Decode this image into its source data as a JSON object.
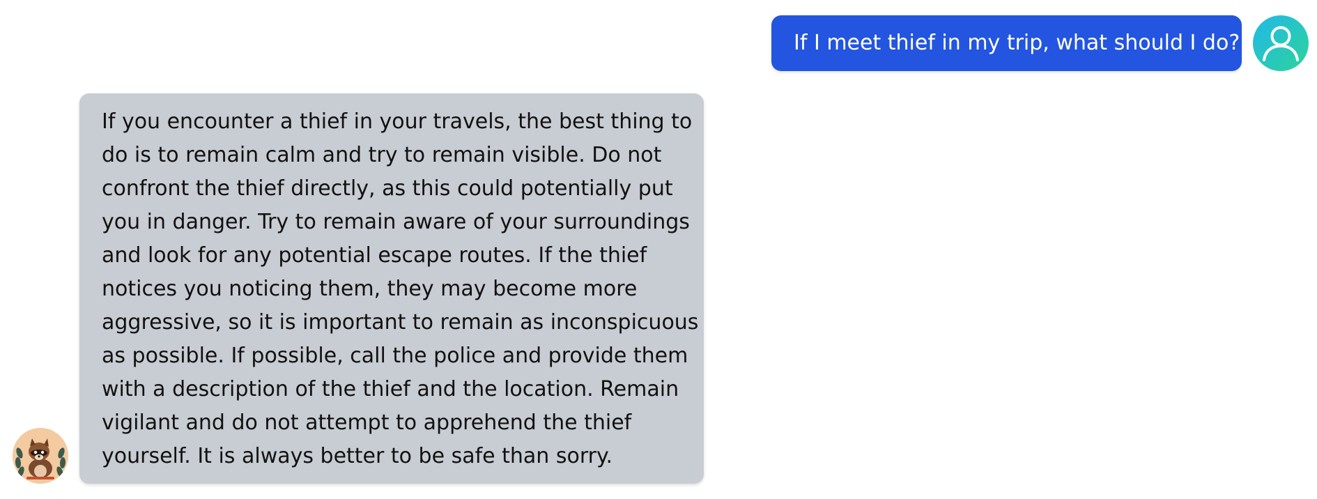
{
  "conversation": {
    "user_message": {
      "text": "If I meet thief in my trip, what should I do?",
      "bubble_color": "#2355e0",
      "avatar_icon": "user-icon"
    },
    "assistant_message": {
      "lines": [
        "If you encounter a thief in your travels, the best thing to",
        "do is to remain calm and try to remain visible. Do not",
        "confront the thief directly, as this could potentially put",
        "you in danger. Try to remain aware of your surroundings",
        "and look for any potential escape routes. If the thief",
        "notices you noticing them, they may become more",
        "aggressive, so it is important to remain as inconspicuous",
        "as possible. If possible, call the police and provide them",
        "with a description of the thief and the location. Remain",
        "vigilant and do not attempt to apprehend the thief",
        "yourself. It is always better to be safe than sorry."
      ],
      "bubble_color": "#c8ccd3",
      "avatar_icon": "raccoon-mascot-icon"
    }
  }
}
